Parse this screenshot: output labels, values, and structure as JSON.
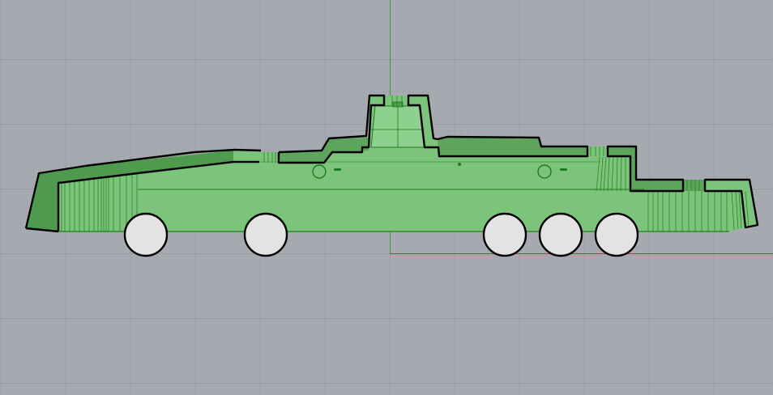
{
  "viewport": {
    "background_color": "#a7abb1",
    "minor_grid_color": "#9ea2a8",
    "major_grid_color": "#8e9298",
    "x_axis_color": "#b03a3a",
    "y_axis_color": "#2e9e3e"
  },
  "model": {
    "fill_color": "#7cc47b",
    "dark_fill_color": "#4f9a4f",
    "mid_fill_color": "#67b065",
    "outline_color": "#000000",
    "edge_color": "#1c7d1c",
    "wheel_fill_color": "#e3e3e3",
    "wheel_count": 5,
    "port_hole_count": 2
  }
}
